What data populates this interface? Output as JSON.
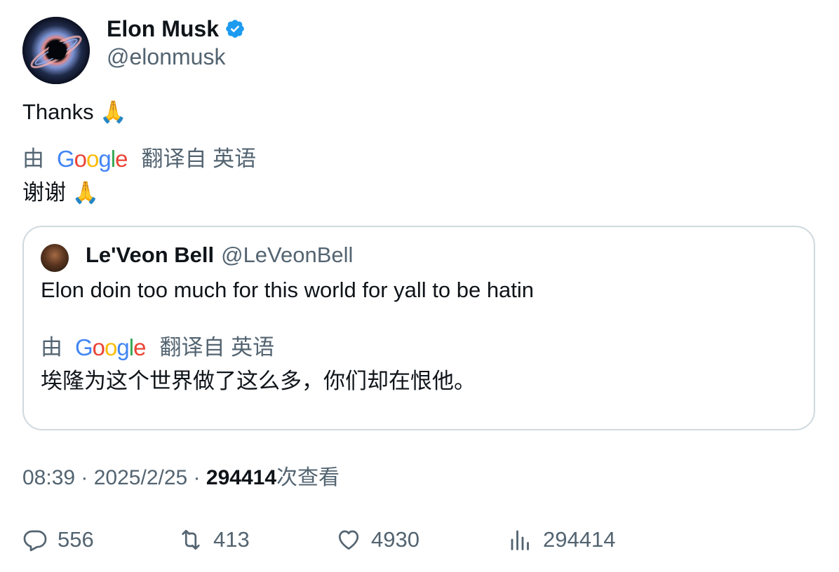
{
  "author": {
    "name": "Elon Musk",
    "handle": "@elonmusk",
    "verified": true,
    "verified_color": "#1d9bf0"
  },
  "tweet": {
    "text": "Thanks",
    "emoji": "🙏",
    "translation": {
      "by_label": "由",
      "provider": "Google",
      "from_label": "翻译自 英语",
      "text": "谢谢",
      "emoji": "🙏"
    }
  },
  "quote": {
    "name": "Le'Veon Bell",
    "handle": "@LeVeonBell",
    "text": "Elon doin too much for this world for yall to be hatin",
    "translation": {
      "by_label": "由",
      "provider": "Google",
      "from_label": "翻译自 英语",
      "text": "埃隆为这个世界做了这么多，你们却在恨他。"
    }
  },
  "meta": {
    "time": "08:39",
    "separator": " · ",
    "date": "2025/2/25",
    "views_count": "294414",
    "views_label": "次查看"
  },
  "actions": {
    "replies": "556",
    "reposts": "413",
    "likes": "4930",
    "views": "294414"
  },
  "colors": {
    "text": "#0f1419",
    "secondary": "#536471",
    "border": "#cfd9de"
  }
}
